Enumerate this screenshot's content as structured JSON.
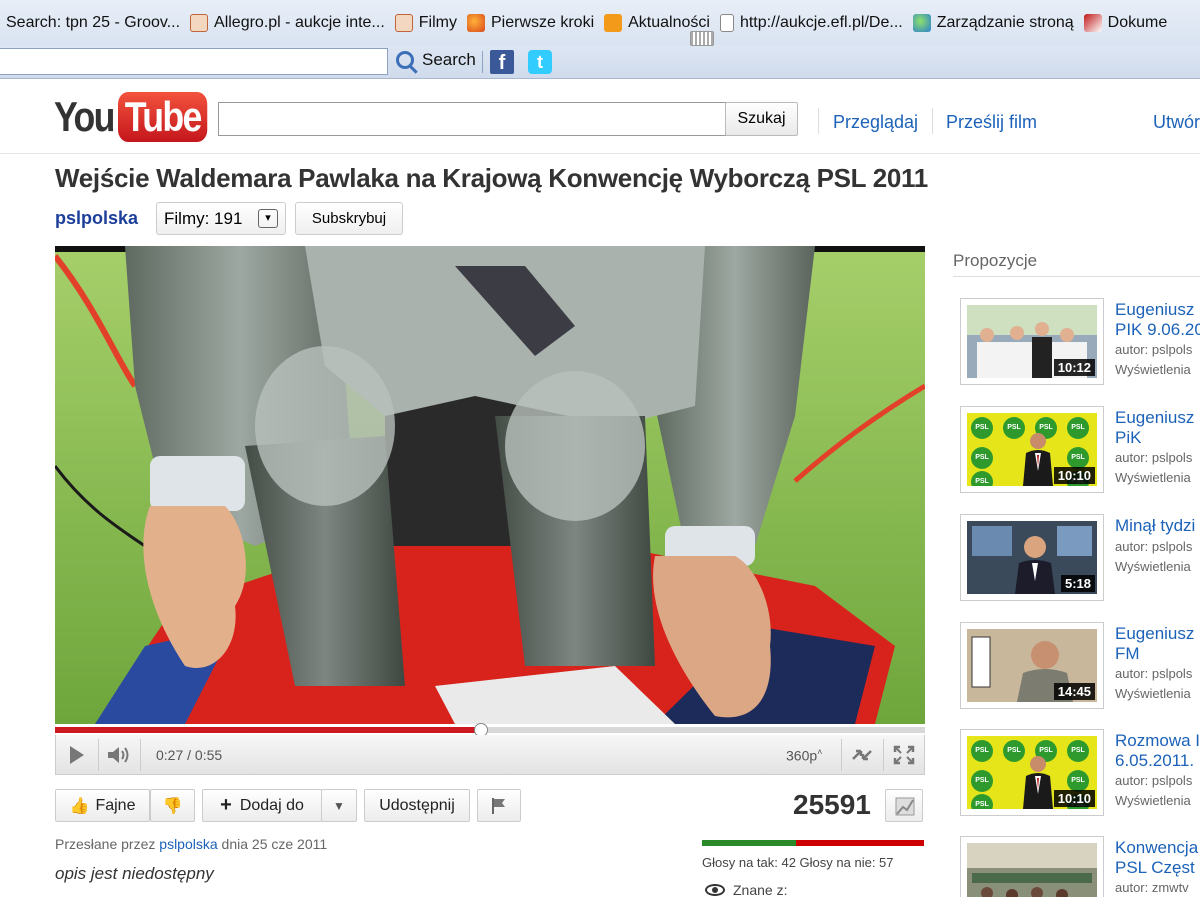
{
  "browser": {
    "bookmarks": [
      {
        "label": "Search: tpn 25 - Groov...",
        "icon": "none"
      },
      {
        "label": "Allegro.pl - aukcje inte...",
        "icon": "hand-icon"
      },
      {
        "label": "Filmy",
        "icon": "hand-icon"
      },
      {
        "label": "Pierwsze kroki",
        "icon": "firefox-icon"
      },
      {
        "label": "Aktualności",
        "icon": "rss-icon"
      },
      {
        "label": "http://aukcje.efl.pl/De...",
        "icon": "page-icon"
      },
      {
        "label": "Zarządzanie stroną",
        "icon": "globe-icon"
      },
      {
        "label": "Dokume",
        "icon": "document-icon"
      }
    ],
    "search_label": "Search",
    "fb_glyph": "f",
    "tw_glyph": "t"
  },
  "yt": {
    "logo_you": "You",
    "logo_tube": "Tube",
    "search_button": "Szukaj",
    "nav": [
      "Przeglądaj",
      "Prześlij film",
      "Utwórz"
    ]
  },
  "video": {
    "title": "Wejście Waldemara Pawlaka na Krajową Konwencję Wyborczą PSL 2011",
    "channel": "pslpolska",
    "films_label": "Filmy: 191",
    "subscribe_label": "Subskrybuj",
    "time": "0:27 / 0:55",
    "quality": "360p",
    "progress": 0.49,
    "buffered": 0.49
  },
  "actions": {
    "like": "Fajne",
    "add": "Dodaj do",
    "share": "Udostępnij",
    "views": "25591"
  },
  "info": {
    "uploaded_prefix": "Przesłane przez",
    "uploaded_user": "pslpolska",
    "uploaded_suffix": "dnia 25 cze 2011",
    "description": "opis jest niedostępny",
    "votes": "Głosy na tak: 42 Głosy na nie: 57",
    "likes": 42,
    "dislikes": 57,
    "known": "Znane z:"
  },
  "sidebar": {
    "title": "Propozycje",
    "items": [
      {
        "title1": "Eugeniusz",
        "title2": "PIK 9.06.20",
        "author": "autor: pslpols",
        "views": "Wyświetlenia",
        "duration": "10:12",
        "thumb": "group"
      },
      {
        "title1": "Eugeniusz",
        "title2": "PiK",
        "author": "autor: pslpols",
        "views": "Wyświetlenia",
        "duration": "10:10",
        "thumb": "psl"
      },
      {
        "title1": "Minął tydzi",
        "title2": "",
        "author": "autor: pslpols",
        "views": "Wyświetlenia",
        "duration": "5:18",
        "thumb": "studio"
      },
      {
        "title1": "Eugeniusz",
        "title2": "FM",
        "author": "autor: pslpols",
        "views": "Wyświetlenia",
        "duration": "14:45",
        "thumb": "radio"
      },
      {
        "title1": "Rozmowa I",
        "title2": "6.05.2011.",
        "author": "autor: pslpols",
        "views": "Wyświetlenia",
        "duration": "10:10",
        "thumb": "psl"
      },
      {
        "title1": "Konwencja",
        "title2": "PSL Częst",
        "author": "autor: zmwtv",
        "views": "",
        "duration": "",
        "thumb": "hall"
      }
    ]
  }
}
